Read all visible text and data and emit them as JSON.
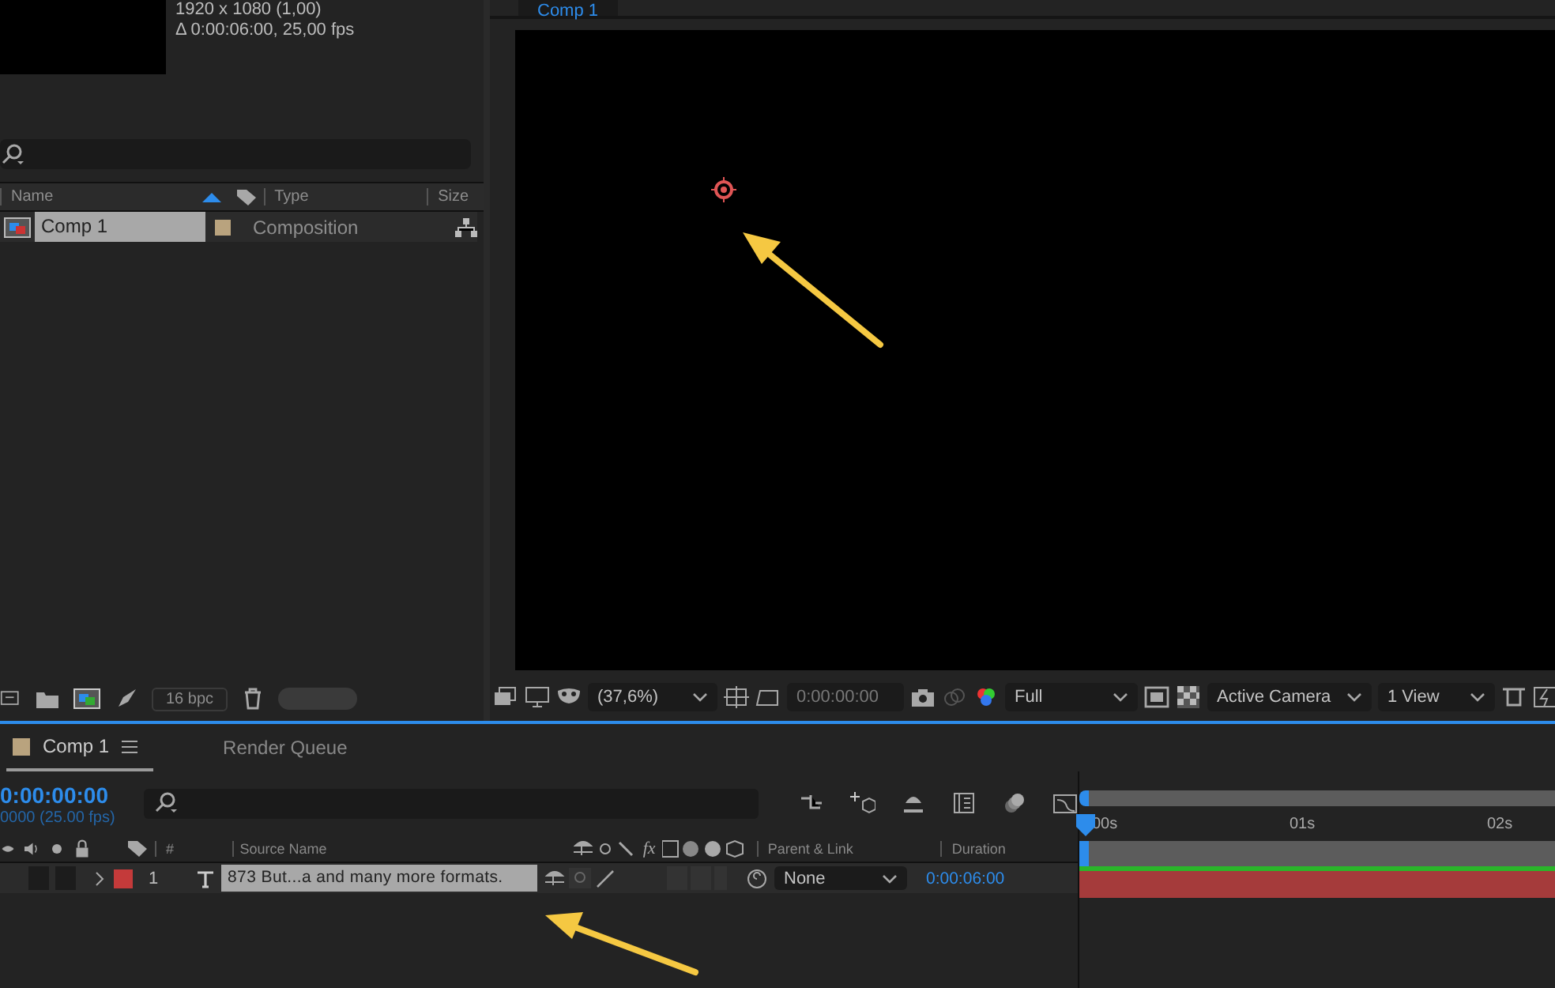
{
  "project_panel": {
    "info_lines": [
      "1920 x 1080 (1,00)",
      "Δ 0:00:06:00, 25,00 fps"
    ],
    "columns": [
      {
        "label": "Name",
        "sorted": true
      },
      {
        "label": "Type",
        "sorted": false
      },
      {
        "label": "Size",
        "sorted": false
      }
    ],
    "items": [
      {
        "name": "Comp 1",
        "type": "Composition",
        "selected": true,
        "color": "#b9a37e"
      }
    ],
    "bit_depth": "16 bpc"
  },
  "viewer": {
    "tab": "Comp 1",
    "zoom": "(37,6%)",
    "timecode": "0:00:00:00",
    "resolution": "Full",
    "camera": "Active Camera",
    "views": "1 View"
  },
  "timeline": {
    "tabs": [
      {
        "label": "Comp 1",
        "selected": true,
        "color": "#b9a37e"
      },
      {
        "label": "Render Queue",
        "selected": false
      }
    ],
    "timecode": "0:00:00:00",
    "frame_info": "0000 (25.00 fps)",
    "columns": [
      "#",
      "Source Name",
      "Parent & Link",
      "Duration"
    ],
    "effects_switch": "fx",
    "layers": [
      {
        "index": "1",
        "name": "873 But...a and many more formats.",
        "selected": true,
        "color": "#c43a3a",
        "parent": "None",
        "duration": "0:00:06:00"
      }
    ],
    "ruler": [
      "00s",
      "01s",
      "02s"
    ]
  }
}
